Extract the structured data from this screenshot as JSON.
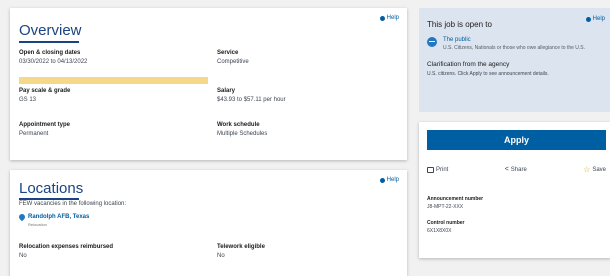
{
  "overview": {
    "title": "Overview",
    "help": "Help",
    "fields": {
      "open_closing": {
        "label": "Open & closing dates",
        "value": "03/30/2022 to 04/13/2022"
      },
      "service": {
        "label": "Service",
        "value": "Competitive"
      },
      "pay_scale": {
        "label": "Pay scale & grade",
        "value": "GS 13"
      },
      "salary": {
        "label": "Salary",
        "value": "$43.93 to $57.11 per hour"
      },
      "appointment": {
        "label": "Appointment type",
        "value": "Permanent"
      },
      "work_schedule": {
        "label": "Work schedule",
        "value": "Multiple Schedules"
      }
    }
  },
  "locations": {
    "title": "Locations",
    "help": "Help",
    "intro": "FEW vacancies in the following location:",
    "place": "Randolph AFB, Texas",
    "place_sub": "Relocation",
    "relocation": {
      "label": "Relocation expenses reimbursed",
      "value": "No"
    },
    "telework": {
      "label": "Telework eligible",
      "value": "No"
    }
  },
  "aside": {
    "title": "This job is open to",
    "help": "Help",
    "public_title": "The public",
    "public_desc": "U.S. Citizens, Nationals or those who owe allegiance to the U.S.",
    "clarification_title": "Clarification from the agency",
    "clarification_desc": "U.S. citizens. Click Apply to see announcement details.",
    "apply_label": "Apply",
    "print_label": "Print",
    "share_label": "Share",
    "save_label": "Save",
    "announcement_label": "Announcement number",
    "announcement_value": "J8-MPT-22-XXX",
    "control_label": "Control number",
    "control_value": "6X1X8X0X"
  }
}
